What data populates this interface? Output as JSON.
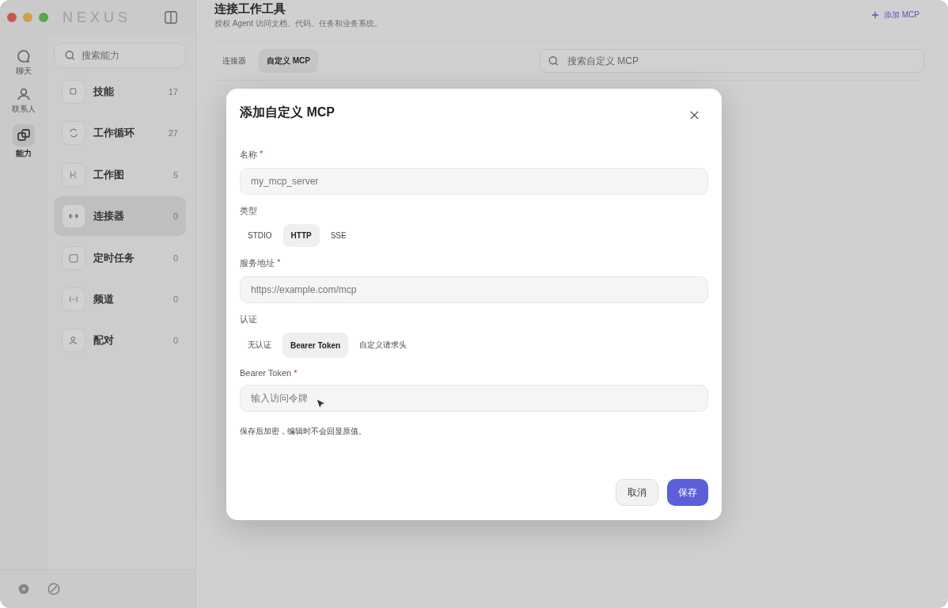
{
  "app": {
    "name": "NEXUS"
  },
  "rail": [
    {
      "label": "聊天",
      "selected": false
    },
    {
      "label": "联系人",
      "selected": false
    },
    {
      "label": "能力",
      "selected": true
    }
  ],
  "sidebar": {
    "search_placeholder": "搜索能力",
    "items": [
      {
        "label": "技能",
        "count": "17",
        "selected": false
      },
      {
        "label": "工作循环",
        "count": "27",
        "selected": false
      },
      {
        "label": "工作图",
        "count": "5",
        "selected": false
      },
      {
        "label": "连接器",
        "count": "0",
        "selected": true
      },
      {
        "label": "定时任务",
        "count": "0",
        "selected": false
      },
      {
        "label": "频道",
        "count": "0",
        "selected": false
      },
      {
        "label": "配对",
        "count": "0",
        "selected": false
      }
    ]
  },
  "header": {
    "title": "连接工作工具",
    "subtitle": "授权 Agent 访问文档、代码、任务和业务系统。",
    "action": "添加 MCP"
  },
  "tabs": [
    {
      "label": "连接器",
      "selected": false
    },
    {
      "label": "自定义 MCP",
      "selected": true
    }
  ],
  "search": {
    "placeholder": "搜索自定义 MCP"
  },
  "dialog": {
    "title": "添加自定义 MCP",
    "fields": [
      {
        "kind": "input",
        "label": "名称",
        "mark": "*",
        "placeholder": "my_mcp_server"
      },
      {
        "kind": "segmented",
        "label": "类型",
        "options": [
          {
            "label": "STDIO",
            "selected": false
          },
          {
            "label": "HTTP",
            "selected": true
          },
          {
            "label": "SSE",
            "selected": false
          }
        ]
      },
      {
        "kind": "input",
        "label": "服务地址",
        "mark": "*",
        "placeholder": "https://example.com/mcp"
      },
      {
        "kind": "segmented",
        "label": "认证",
        "options": [
          {
            "label": "无认证",
            "selected": false
          },
          {
            "label": "Bearer Token",
            "selected": true
          },
          {
            "label": "自定义请求头",
            "selected": false
          }
        ]
      },
      {
        "kind": "input",
        "label": "Bearer Token",
        "mark": "*",
        "placeholder": "输入访问令牌",
        "help": "保存后加密，编辑时不会回显原值。"
      }
    ],
    "buttons": [
      {
        "label": "取消",
        "kind": "secondary"
      },
      {
        "label": "保存",
        "kind": "primary"
      }
    ]
  }
}
